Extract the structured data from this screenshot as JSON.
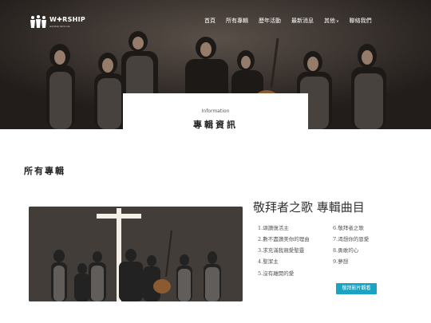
{
  "header": {
    "logo_text": "W✚RSHIP",
    "logo_sub": "worship de la vie",
    "nav": [
      "首頁",
      "所有專輯",
      "歷年活動",
      "最新消息",
      "其他",
      "聯絡我們"
    ]
  },
  "info_card": {
    "small": "Information",
    "title": "專輯資訊"
  },
  "section": {
    "title": "所有專輯"
  },
  "album": {
    "title": "敬拜者之歌 專輯曲目",
    "tracks_left": [
      "1.頌讚復活主",
      "2.數不盡讚美你的理由",
      "3.求充滿我親愛聖靈",
      "4.聖潔主",
      "5.沒有離開的愛"
    ],
    "tracks_right": [
      "6.敬拜者之歌",
      "7.渴想你的恩愛",
      "8.勇敢的心",
      "9.夢想"
    ],
    "button": "敬拜影片觀看"
  },
  "colors": {
    "accent": "#1aa3c2",
    "hero_bg": "#2e2826"
  }
}
